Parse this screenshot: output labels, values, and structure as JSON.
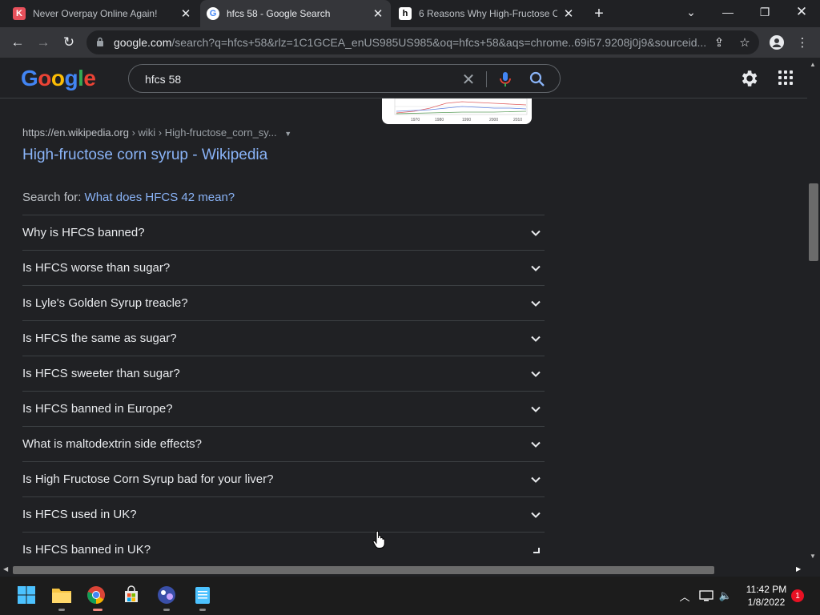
{
  "browser": {
    "tabs": [
      {
        "title": "Never Overpay Online Again!",
        "favicon": "K",
        "favicon_color": "#e8505b"
      },
      {
        "title": "hfcs 58 - Google Search",
        "favicon": "G",
        "favicon_color": "#ffffff"
      },
      {
        "title": "6 Reasons Why High-Fructose Co",
        "favicon": "h",
        "favicon_color": "#000000"
      }
    ],
    "url_domain": "google.com",
    "url_path": "/search?q=hfcs+58&rlz=1C1GCEA_enUS985US985&oq=hfcs+58&aqs=chrome..69i57.9208j0j9&sourceid..."
  },
  "google": {
    "logo": [
      "G",
      "o",
      "o",
      "g",
      "l",
      "e"
    ],
    "search_value": "hfcs 58"
  },
  "result": {
    "cite_domain": "https://en.wikipedia.org",
    "cite_path": " › wiki › High-fructose_corn_sy...",
    "title": "High-fructose corn syrup - Wikipedia"
  },
  "search_for": {
    "label": "Search for: ",
    "query": "What does HFCS 42 mean?"
  },
  "paa": [
    "Why is HFCS banned?",
    "Is HFCS worse than sugar?",
    "Is Lyle's Golden Syrup treacle?",
    "Is HFCS the same as sugar?",
    "Is HFCS sweeter than sugar?",
    "Is HFCS banned in Europe?",
    "What is maltodextrin side effects?",
    "Is High Fructose Corn Syrup bad for your liver?",
    "Is HFCS used in UK?",
    "Is HFCS banned in UK?"
  ],
  "thumb_ticks": [
    "1970",
    "1980",
    "1990",
    "2000",
    "2010"
  ],
  "taskbar": {
    "time": "11:42 PM",
    "date": "1/8/2022",
    "notifications": "1"
  },
  "colors": {
    "link": "#8ab4f8",
    "background": "#202124",
    "divider": "#3c4043"
  }
}
